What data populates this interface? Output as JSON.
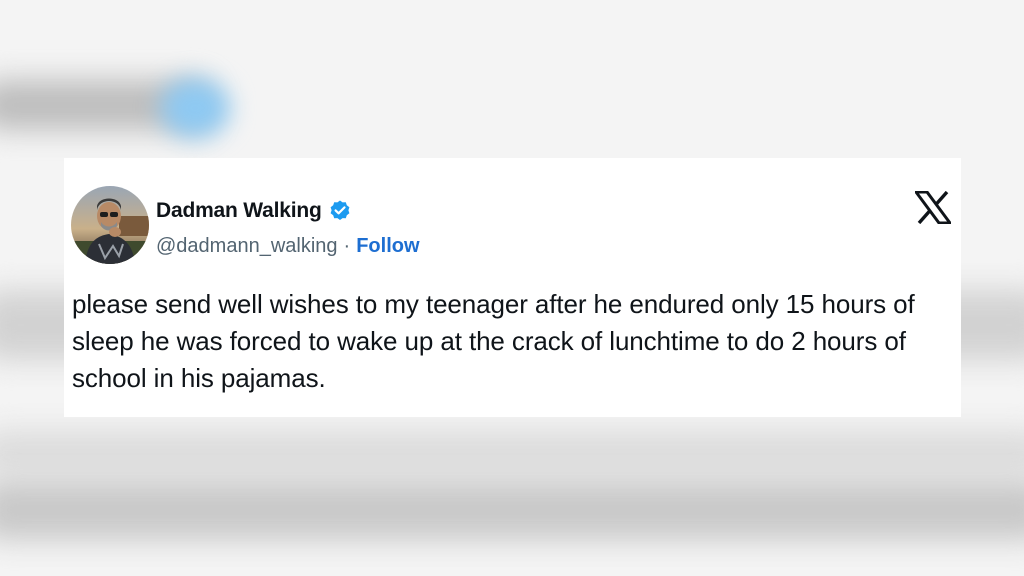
{
  "tweet": {
    "display_name": "Dadman Walking",
    "handle": "@dadmann_walking",
    "separator": "·",
    "follow_label": "Follow",
    "verified_icon": "verified-badge-icon",
    "platform_icon": "x-logo-icon",
    "text": "please send well wishes to my teenager after he endured only 15 hours of sleep he was forced to wake up at the crack of lunchtime to do 2 hours of school in his pajamas."
  },
  "colors": {
    "verified_blue": "#1d9bf0",
    "follow_blue": "#1d6ed1",
    "handle_gray": "#536471",
    "text_dark": "#0f1419"
  }
}
